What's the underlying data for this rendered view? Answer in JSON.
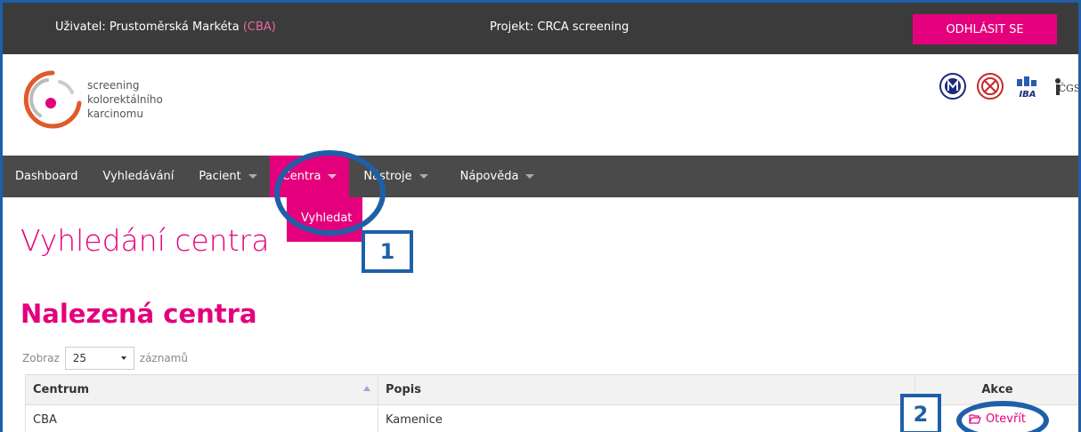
{
  "topbar": {
    "user_label": "Uživatel: Prustoměrská Markéta",
    "user_org": "(CBA)",
    "project_label": "Projekt: CRCA screening",
    "logout_label": "ODHLÁSIT SE"
  },
  "brand": {
    "line1": "screening",
    "line2": "kolorektálního",
    "line3": "karcinomu",
    "accent_color": "#e4007c"
  },
  "partners": [
    "MU-logo",
    "CSK-logo",
    "IBA-logo",
    "CGS-logo"
  ],
  "nav": {
    "items": [
      {
        "label": "Dashboard",
        "has_caret": false
      },
      {
        "label": "Vyhledávání",
        "has_caret": false
      },
      {
        "label": "Pacient",
        "has_caret": true
      },
      {
        "label": "Centra",
        "has_caret": true,
        "active": true
      },
      {
        "label": "Nástroje",
        "has_caret": true
      },
      {
        "label": "Nápověda",
        "has_caret": true
      }
    ],
    "dropdown_item": "Vyhledat"
  },
  "page": {
    "title": "Vyhledání centra",
    "section_title": "Nalezená centra"
  },
  "length_control": {
    "prefix": "Zobraz",
    "value": "25",
    "suffix": "záznamů"
  },
  "table": {
    "headers": [
      "Centrum",
      "Popis",
      "Akce"
    ],
    "rows": [
      {
        "centrum": "CBA",
        "popis": "Kamenice",
        "akce": "Otevřít"
      }
    ]
  },
  "annotations": {
    "badge1": "1",
    "badge2": "2",
    "color": "#1f5fa8"
  }
}
